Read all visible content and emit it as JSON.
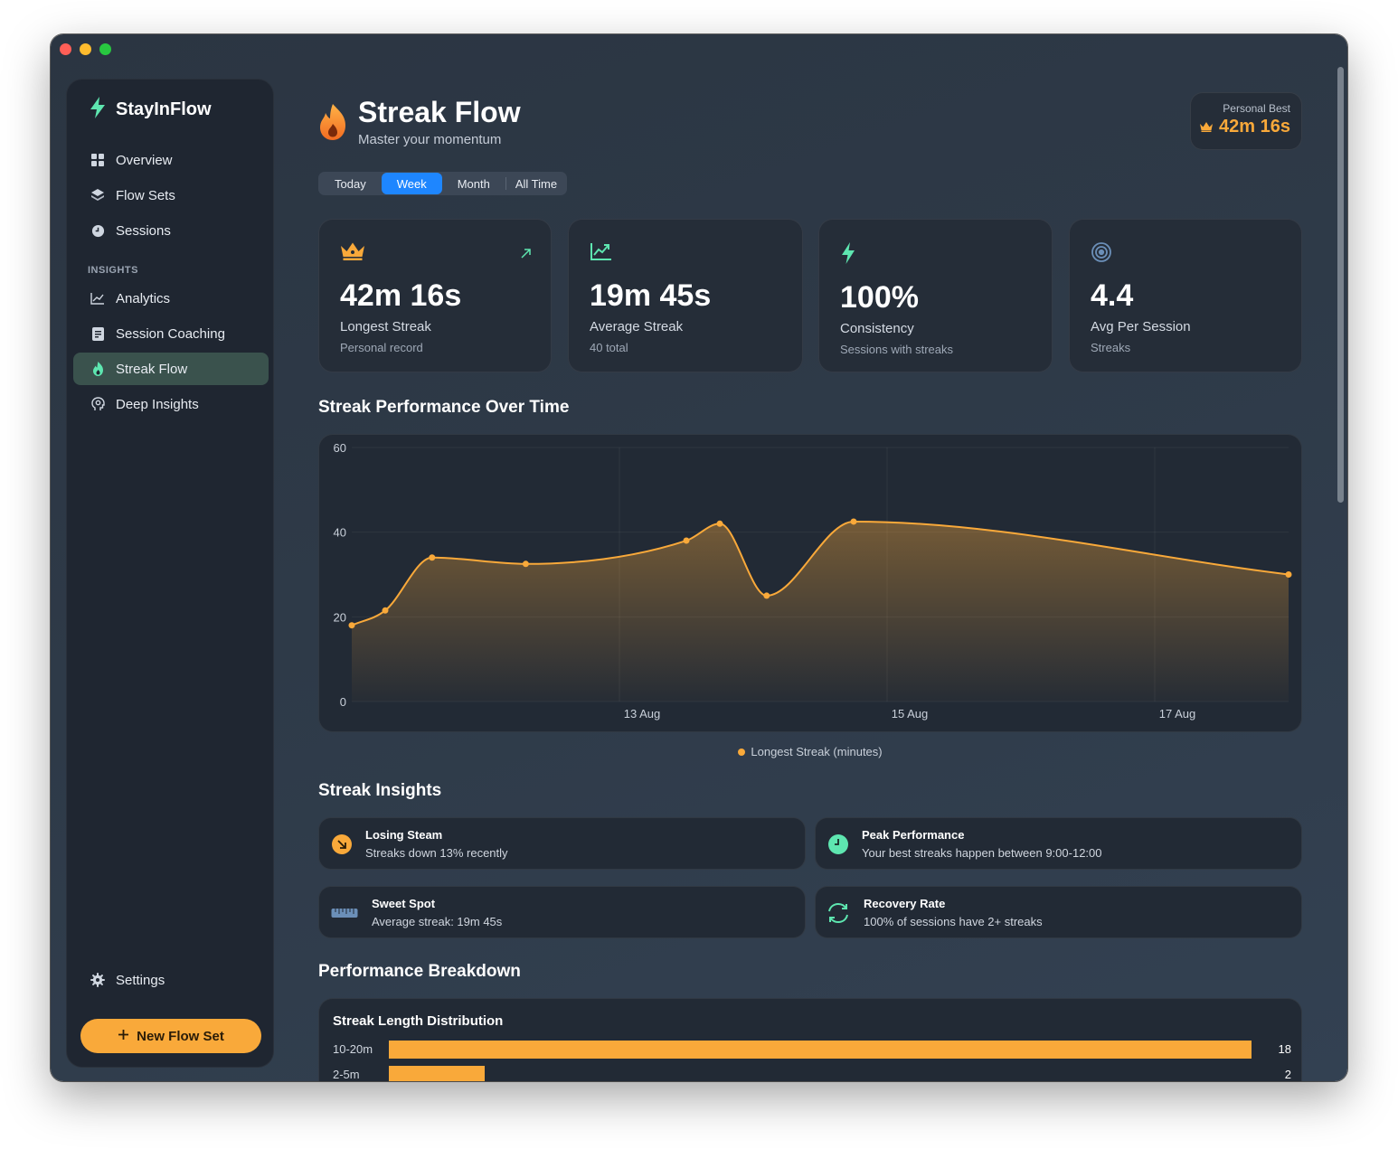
{
  "app": {
    "name": "StayInFlow"
  },
  "sidebar": {
    "items": [
      {
        "label": "Overview",
        "icon": "grid-icon"
      },
      {
        "label": "Flow Sets",
        "icon": "layers-icon"
      },
      {
        "label": "Sessions",
        "icon": "clock-icon"
      }
    ],
    "section_label": "INSIGHTS",
    "insight_items": [
      {
        "label": "Analytics",
        "icon": "line-chart-icon"
      },
      {
        "label": "Session Coaching",
        "icon": "notebook-icon"
      },
      {
        "label": "Streak Flow",
        "icon": "flame-icon",
        "active": true
      },
      {
        "label": "Deep Insights",
        "icon": "head-icon"
      }
    ],
    "settings_label": "Settings",
    "new_button_label": "New Flow Set"
  },
  "header": {
    "title": "Streak Flow",
    "subtitle": "Master your momentum",
    "personal_best_label": "Personal Best",
    "personal_best_value": "42m 16s"
  },
  "range_tabs": [
    {
      "label": "Today"
    },
    {
      "label": "Week",
      "selected": true
    },
    {
      "label": "Month"
    },
    {
      "label": "All Time"
    }
  ],
  "stats": [
    {
      "value": "42m 16s",
      "label": "Longest Streak",
      "sub": "Personal record",
      "icon": "crown-icon"
    },
    {
      "value": "19m 45s",
      "label": "Average Streak",
      "sub": "40 total",
      "icon": "trend-icon"
    },
    {
      "value": "100%",
      "label": "Consistency",
      "sub": "Sessions with streaks",
      "icon": "bolt-icon"
    },
    {
      "value": "4.4",
      "label": "Avg Per Session",
      "sub": "Streaks",
      "icon": "target-icon"
    }
  ],
  "chart_section_title": "Streak Performance Over Time",
  "chart_data": {
    "type": "area",
    "x": [
      11.0,
      11.25,
      11.6,
      12.3,
      13.5,
      13.75,
      14.1,
      14.75,
      18.0
    ],
    "values": [
      18,
      21.5,
      34,
      32.5,
      38,
      42,
      25,
      42.5,
      30
    ],
    "x_ticks": [
      {
        "value": 13,
        "label": "13 Aug"
      },
      {
        "value": 15,
        "label": "15 Aug"
      },
      {
        "value": 17,
        "label": "17 Aug"
      }
    ],
    "y_ticks": [
      0,
      20,
      40,
      60
    ],
    "xlim": [
      11.0,
      18.0
    ],
    "ylim": [
      0,
      60
    ],
    "series_name": "Longest Streak (minutes)",
    "color": "#f9a93a",
    "grid": true,
    "legend_position": "bottom"
  },
  "insights_section_title": "Streak Insights",
  "insights": [
    {
      "title": "Losing Steam",
      "desc": "Streaks down 13% recently",
      "icon": "arrow-down-right-icon",
      "color": "#f9a93a"
    },
    {
      "title": "Peak Performance",
      "desc": "Your best streaks happen between 9:00-12:00",
      "icon": "clock-icon",
      "color": "#5ee6b0"
    },
    {
      "title": "Sweet Spot",
      "desc": "Average streak: 19m 45s",
      "icon": "ruler-icon",
      "color": "#6b8fb8"
    },
    {
      "title": "Recovery Rate",
      "desc": "100% of sessions have 2+ streaks",
      "icon": "refresh-icon",
      "color": "#5ee6b0"
    }
  ],
  "breakdown_section_title": "Performance Breakdown",
  "breakdown": {
    "title": "Streak Length Distribution",
    "rows": [
      {
        "label": "10-20m",
        "count": 18,
        "fraction": 1.0
      },
      {
        "label": "2-5m",
        "count": 2,
        "fraction": 0.111
      }
    ]
  }
}
